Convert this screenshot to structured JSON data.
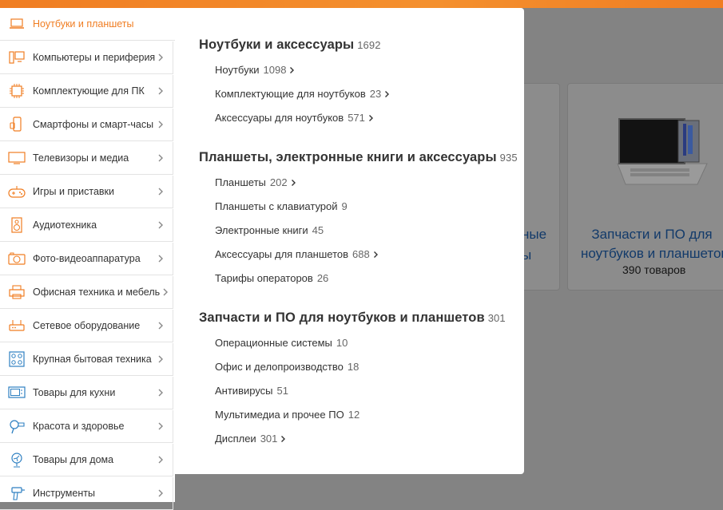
{
  "sidebar": {
    "items": [
      {
        "label": "Ноутбуки и планшеты",
        "icon": "laptop-icon",
        "active": true
      },
      {
        "label": "Компьютеры и периферия",
        "icon": "computer-icon"
      },
      {
        "label": "Комплектующие для ПК",
        "icon": "cpu-chip-icon"
      },
      {
        "label": "Смартфоны и смарт-часы",
        "icon": "smartphone-icon"
      },
      {
        "label": "Телевизоры и медиа",
        "icon": "tv-icon"
      },
      {
        "label": "Игры и приставки",
        "icon": "gamepad-icon"
      },
      {
        "label": "Аудиотехника",
        "icon": "speaker-icon"
      },
      {
        "label": "Фото-видеоаппаратура",
        "icon": "camera-icon"
      },
      {
        "label": "Офисная техника и мебель",
        "icon": "printer-icon"
      },
      {
        "label": "Сетевое оборудование",
        "icon": "router-icon"
      },
      {
        "label": "Крупная бытовая техника",
        "icon": "stove-icon"
      },
      {
        "label": "Товары для кухни",
        "icon": "microwave-icon"
      },
      {
        "label": "Красота и здоровье",
        "icon": "hairdryer-icon"
      },
      {
        "label": "Товары для дома",
        "icon": "fan-icon"
      },
      {
        "label": "Инструменты",
        "icon": "drill-icon"
      }
    ]
  },
  "panel": {
    "groups": [
      {
        "title": "Ноутбуки и аксессуары",
        "count": "1692",
        "links": [
          {
            "label": "Ноутбуки",
            "count": "1098",
            "arrow": true
          },
          {
            "label": "Комплектующие для ноутбуков",
            "count": "23",
            "arrow": true
          },
          {
            "label": "Аксессуары для ноутбуков",
            "count": "571",
            "arrow": true
          }
        ]
      },
      {
        "title": "Планшеты, электронные книги и аксессуары",
        "count": "935",
        "links": [
          {
            "label": "Планшеты",
            "count": "202",
            "arrow": true
          },
          {
            "label": "Планшеты с клавиатурой",
            "count": "9",
            "arrow": false
          },
          {
            "label": "Электронные книги",
            "count": "45",
            "arrow": false
          },
          {
            "label": "Аксессуары для планшетов",
            "count": "688",
            "arrow": true
          },
          {
            "label": "Тарифы операторов",
            "count": "26",
            "arrow": false
          }
        ]
      },
      {
        "title": "Запчасти и ПО для ноутбуков и планшетов",
        "count": "301",
        "links": [
          {
            "label": "Операционные системы",
            "count": "10",
            "arrow": false
          },
          {
            "label": "Офис и делопроизводство",
            "count": "18",
            "arrow": false
          },
          {
            "label": "Антивирусы",
            "count": "51",
            "arrow": false
          },
          {
            "label": "Мультимедиа и прочее ПО",
            "count": "12",
            "arrow": false
          },
          {
            "label": "Дисплеи",
            "count": "301",
            "arrow": true
          }
        ]
      }
    ]
  },
  "background": {
    "card_left_line1": "ные",
    "card_left_line2": "ы",
    "card_right_line1": "Запчасти и ПО для",
    "card_right_line2": "ноутбуков и планшетов",
    "card_right_count": "390 товаров"
  },
  "colors": {
    "accent": "#f07d22",
    "link_blue": "#1a5aa6",
    "text": "#333333"
  }
}
